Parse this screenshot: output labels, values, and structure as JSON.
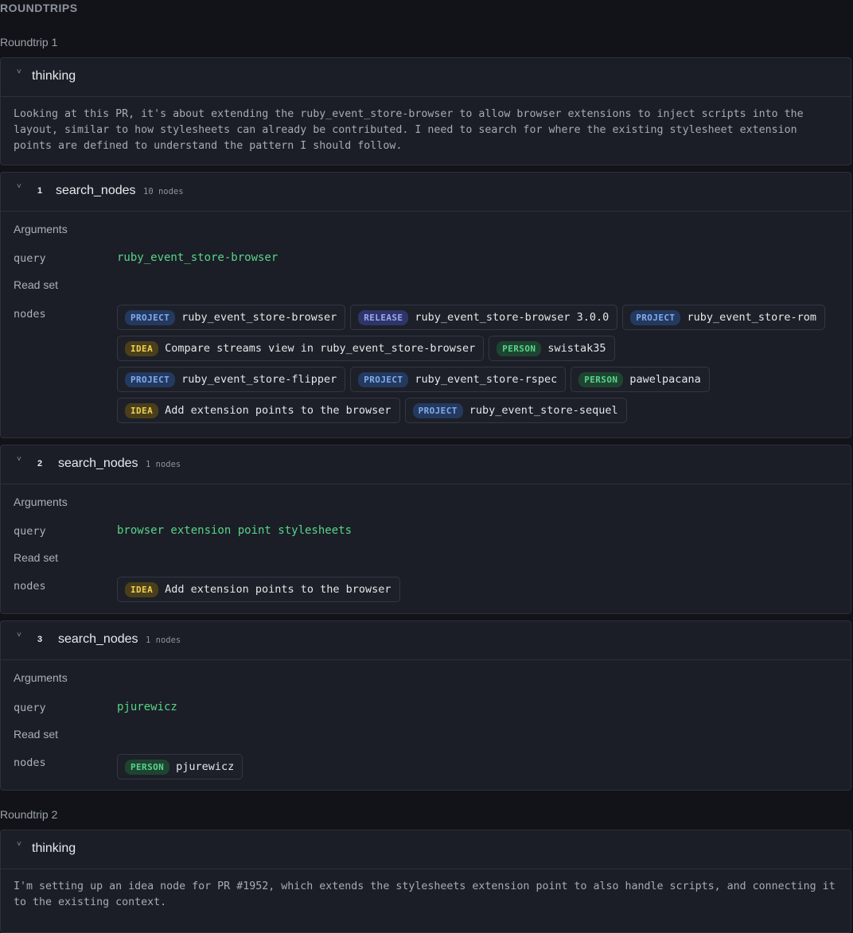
{
  "section_title": "ROUNDTRIPS",
  "roundtrips": [
    {
      "label": "Roundtrip 1",
      "thinking": {
        "title": "thinking",
        "text": "Looking at this PR, it's about extending the ruby_event_store-browser to allow browser extensions to inject scripts into the layout, similar to how stylesheets can already be contributed. I need to search for where the existing stylesheet extension points are defined to understand the pattern I should follow."
      },
      "steps": [
        {
          "num": "1",
          "tool": "search_nodes",
          "count": "10 nodes",
          "arguments_label": "Arguments",
          "query_key": "query",
          "query": "ruby_event_store-browser",
          "readset_label": "Read set",
          "nodes_key": "nodes",
          "nodes": [
            {
              "type": "PROJECT",
              "name": "ruby_event_store-browser"
            },
            {
              "type": "RELEASE",
              "name": "ruby_event_store-browser 3.0.0"
            },
            {
              "type": "PROJECT",
              "name": "ruby_event_store-rom"
            },
            {
              "type": "IDEA",
              "name": "Compare streams view in ruby_event_store-browser"
            },
            {
              "type": "PERSON",
              "name": "swistak35"
            },
            {
              "type": "PROJECT",
              "name": "ruby_event_store-flipper"
            },
            {
              "type": "PROJECT",
              "name": "ruby_event_store-rspec"
            },
            {
              "type": "PERSON",
              "name": "pawelpacana"
            },
            {
              "type": "IDEA",
              "name": "Add extension points to the browser"
            },
            {
              "type": "PROJECT",
              "name": "ruby_event_store-sequel"
            }
          ]
        },
        {
          "num": "2",
          "tool": "search_nodes",
          "count": "1 nodes",
          "arguments_label": "Arguments",
          "query_key": "query",
          "query": "browser extension point stylesheets",
          "readset_label": "Read set",
          "nodes_key": "nodes",
          "nodes": [
            {
              "type": "IDEA",
              "name": "Add extension points to the browser"
            }
          ]
        },
        {
          "num": "3",
          "tool": "search_nodes",
          "count": "1 nodes",
          "arguments_label": "Arguments",
          "query_key": "query",
          "query": "pjurewicz",
          "readset_label": "Read set",
          "nodes_key": "nodes",
          "nodes": [
            {
              "type": "PERSON",
              "name": "pjurewicz"
            }
          ]
        }
      ]
    },
    {
      "label": "Roundtrip 2",
      "thinking": {
        "title": "thinking",
        "text": "I'm setting up an idea node for PR #1952, which extends the stylesheets extension point to also handle scripts, and connecting it to the existing context."
      }
    }
  ],
  "colors": {
    "background": "#111318",
    "card": "#1b1e26",
    "query_green": "#58d48a",
    "project_blue": "#7eacf0",
    "release_indigo": "#9ba7f2",
    "idea_yellow": "#f0cf54",
    "person_green": "#58d48a"
  },
  "icons": {
    "collapse": "chevron-down-icon"
  }
}
